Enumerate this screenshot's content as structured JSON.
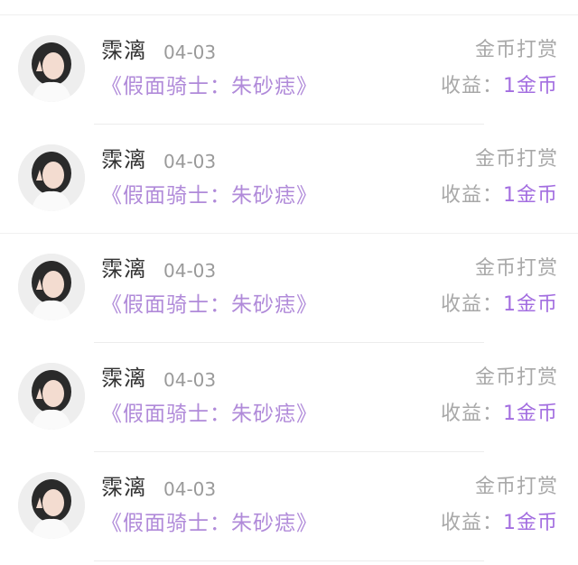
{
  "items": [
    {
      "name": "霂漓",
      "date": "04-03",
      "type": "金币打赏",
      "work": "《假面骑士：朱砂痣》",
      "earnings_label": "收益：",
      "earnings_value": "1金币"
    },
    {
      "name": "霂漓",
      "date": "04-03",
      "type": "金币打赏",
      "work": "《假面骑士：朱砂痣》",
      "earnings_label": "收益：",
      "earnings_value": "1金币"
    },
    {
      "name": "霂漓",
      "date": "04-03",
      "type": "金币打赏",
      "work": "《假面骑士：朱砂痣》",
      "earnings_label": "收益：",
      "earnings_value": "1金币"
    },
    {
      "name": "霂漓",
      "date": "04-03",
      "type": "金币打赏",
      "work": "《假面骑士：朱砂痣》",
      "earnings_label": "收益：",
      "earnings_value": "1金币"
    },
    {
      "name": "霂漓",
      "date": "04-03",
      "type": "金币打赏",
      "work": "《假面骑士：朱砂痣》",
      "earnings_label": "收益：",
      "earnings_value": "1金币"
    }
  ],
  "colors": {
    "work_title": "#b08ad9",
    "earnings_value": "#a36ee0",
    "muted_text": "#a8a8a8"
  },
  "icons": {
    "avatar": "user-avatar-photo"
  }
}
